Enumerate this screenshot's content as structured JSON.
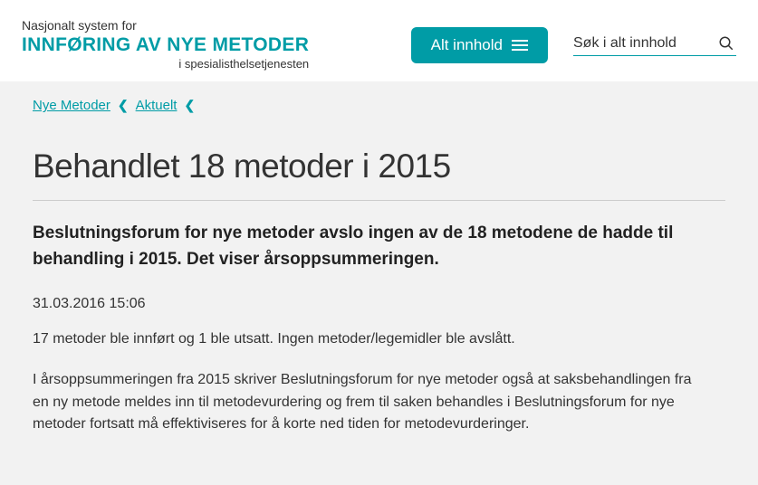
{
  "header": {
    "logo_line1": "Nasjonalt system for",
    "logo_line2": "INNFØRING AV NYE METODER",
    "logo_line3": "i spesialisthelsetjenesten",
    "dropdown_label": "Alt innhold",
    "search_placeholder": "Søk i alt innhold"
  },
  "breadcrumb": {
    "item1": "Nye Metoder",
    "item2": "Aktuelt"
  },
  "article": {
    "title": "Behandlet 18 metoder i 2015",
    "lead": "Beslutningsforum for nye metoder avslo ingen av de 18 metodene de hadde til behandling i 2015. Det viser årsoppsummeringen.",
    "timestamp": "31.03.2016 15:06",
    "para1": "17 metoder ble innført og 1 ble utsatt. Ingen metoder/legemidler ble avslått.",
    "para2": "I årsoppsummeringen fra 2015 skriver Beslutningsforum for nye metoder også at saksbehandlingen fra en ny metode meldes inn til metodevurdering og frem til saken behandles i Beslutningsforum for nye metoder fortsatt må effektiviseres for å korte ned tiden for metodevurderinger."
  }
}
